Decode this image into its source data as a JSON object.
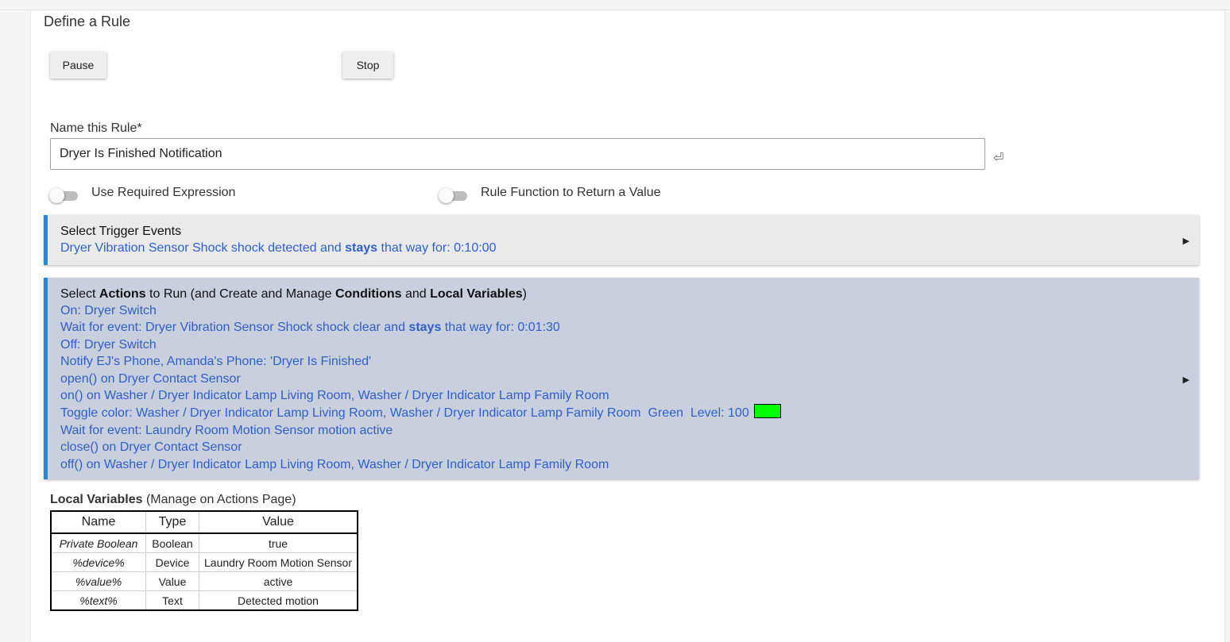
{
  "page": {
    "title": "Define a Rule"
  },
  "buttons": {
    "pause": "Pause",
    "stop": "Stop"
  },
  "name_field": {
    "label": "Name this Rule*",
    "value": "Dryer Is Finished Notification",
    "enter_icon": "⏎"
  },
  "toggles": [
    {
      "label": "Use Required Expression",
      "on": false
    },
    {
      "label": "Rule Function to Return a Value",
      "on": false
    }
  ],
  "trigger_section": {
    "title": "Select Trigger Events",
    "line": {
      "before": "Dryer Vibration Sensor Shock shock detected and ",
      "bold": "stays",
      "after": " that way for: 0:10:00"
    },
    "arrow": "▶"
  },
  "actions_section": {
    "title": {
      "t1": "Select ",
      "b1": "Actions",
      "t2": " to Run (and Create and Manage ",
      "b2": "Conditions",
      "t3": " and ",
      "b3": "Local Variables",
      "t4": ")"
    },
    "lines": [
      "On: Dryer Switch",
      {
        "before": "Wait for event: Dryer Vibration Sensor Shock shock clear and ",
        "bold": "stays",
        "after": " that way for: 0:01:30"
      },
      "Off: Dryer Switch",
      "Notify EJ's Phone, Amanda's Phone: 'Dryer Is Finished'",
      "open() on Dryer Contact Sensor",
      "on() on Washer / Dryer Indicator Lamp Living Room, Washer / Dryer Indicator Lamp Family Room",
      "Toggle color: Washer / Dryer Indicator Lamp Living Room, Washer / Dryer Indicator Lamp Family Room  Green  Level: 100",
      "Wait for event: Laundry Room Motion Sensor motion active",
      "close() on Dryer Contact Sensor",
      "off() on Washer / Dryer Indicator Lamp Living Room, Washer / Dryer Indicator Lamp Family Room"
    ],
    "color_swatch": "#00ff00",
    "arrow": "▶"
  },
  "local_variables": {
    "title_bold": "Local Variables",
    "title_rest": " (Manage on Actions Page)",
    "headers": [
      "Name",
      "Type",
      "Value"
    ],
    "rows": [
      [
        "Private Boolean",
        "Boolean",
        "true"
      ],
      [
        "%device%",
        "Device",
        "Laundry Room Motion Sensor"
      ],
      [
        "%value%",
        "Value",
        "active"
      ],
      [
        "%text%",
        "Text",
        "Detected motion"
      ]
    ]
  },
  "colors": {
    "accent": "#1e88e5",
    "link": "#2f5fcb",
    "actions_bg": "#c9cfdc",
    "trigger_bg": "#eaeaea"
  }
}
